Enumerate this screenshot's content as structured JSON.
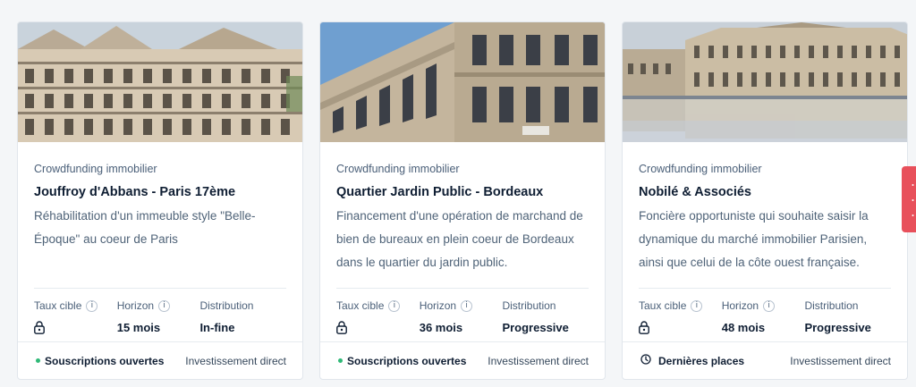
{
  "cards": [
    {
      "image_alt": "Haussmann style building facade in Paris",
      "category": "Crowdfunding immobilier",
      "title": "Jouffroy d'Abbans - Paris 17ème",
      "description": "Réhabilitation d'un immeuble style \"Belle-Époque\" au coeur de Paris",
      "metrics": {
        "rate_label": "Taux cible",
        "horizon_label": "Horizon",
        "horizon_value": "15 mois",
        "distribution_label": "Distribution",
        "distribution_value": "In-fine"
      },
      "status": "Souscriptions ouvertes",
      "status_icon": "dot-icon",
      "investment_type": "Investissement direct"
    },
    {
      "image_alt": "Stone office building in Bordeaux",
      "category": "Crowdfunding immobilier",
      "title": "Quartier Jardin Public - Bordeaux",
      "description": "Financement d'une opération de marchand de bien de bureaux en plein coeur de Bordeaux dans le quartier du jardin public.",
      "metrics": {
        "rate_label": "Taux cible",
        "horizon_label": "Horizon",
        "horizon_value": "36 mois",
        "distribution_label": "Distribution",
        "distribution_value": "Progressive"
      },
      "status": "Souscriptions ouvertes",
      "status_icon": "dot-icon",
      "investment_type": "Investissement direct"
    },
    {
      "image_alt": "Place de la Bourse reflected in the water mirror, Bordeaux",
      "category": "Crowdfunding immobilier",
      "title": "Nobilé & Associés",
      "description": "Foncière opportuniste qui souhaite saisir la dynamique du marché immobilier Parisien, ainsi que celui de la côte ouest française.",
      "metrics": {
        "rate_label": "Taux cible",
        "horizon_label": "Horizon",
        "horizon_value": "48 mois",
        "distribution_label": "Distribution",
        "distribution_value": "Progressive"
      },
      "status": "Dernières places",
      "status_icon": "clock-icon",
      "investment_type": "Investissement direct"
    }
  ],
  "info_glyph": "i",
  "colors": {
    "accent_green": "#2fb977",
    "side_tab_red": "#e8505b",
    "title_text": "#0f1e33",
    "muted_text": "#4b6079"
  }
}
